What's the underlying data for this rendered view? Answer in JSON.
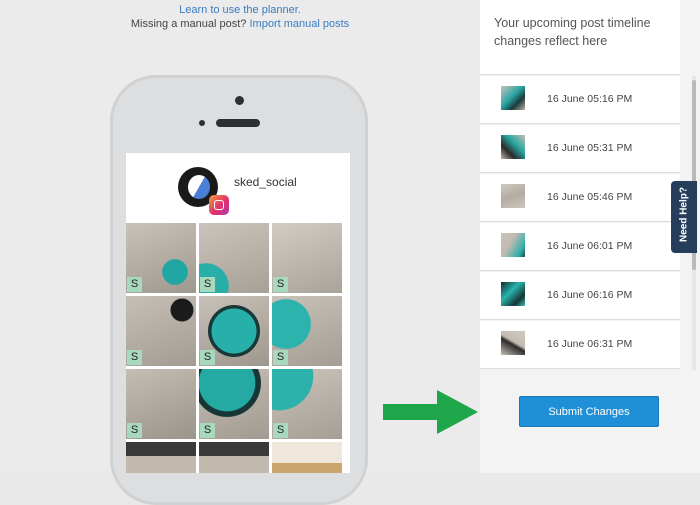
{
  "header": {
    "learn_link": "Learn to use the planner.",
    "missing_text": "Missing a manual post?",
    "import_link": "Import manual posts"
  },
  "profile": {
    "handle": "sked_social"
  },
  "grid": {
    "badge": "S"
  },
  "timeline": {
    "heading": "Your upcoming post timeline changes reflect here",
    "posts": [
      {
        "time": "16 June 05:16 PM"
      },
      {
        "time": "16 June 05:31 PM"
      },
      {
        "time": "16 June 05:46 PM"
      },
      {
        "time": "16 June 06:01 PM"
      },
      {
        "time": "16 June 06:16 PM"
      },
      {
        "time": "16 June 06:31 PM"
      }
    ]
  },
  "actions": {
    "submit_label": "Submit Changes",
    "help_label": "Need Help?"
  },
  "colors": {
    "accent": "#1f8fd8",
    "badge": "#a8d8be",
    "help_tab": "#263e5c",
    "arrow": "#1fa64b"
  }
}
